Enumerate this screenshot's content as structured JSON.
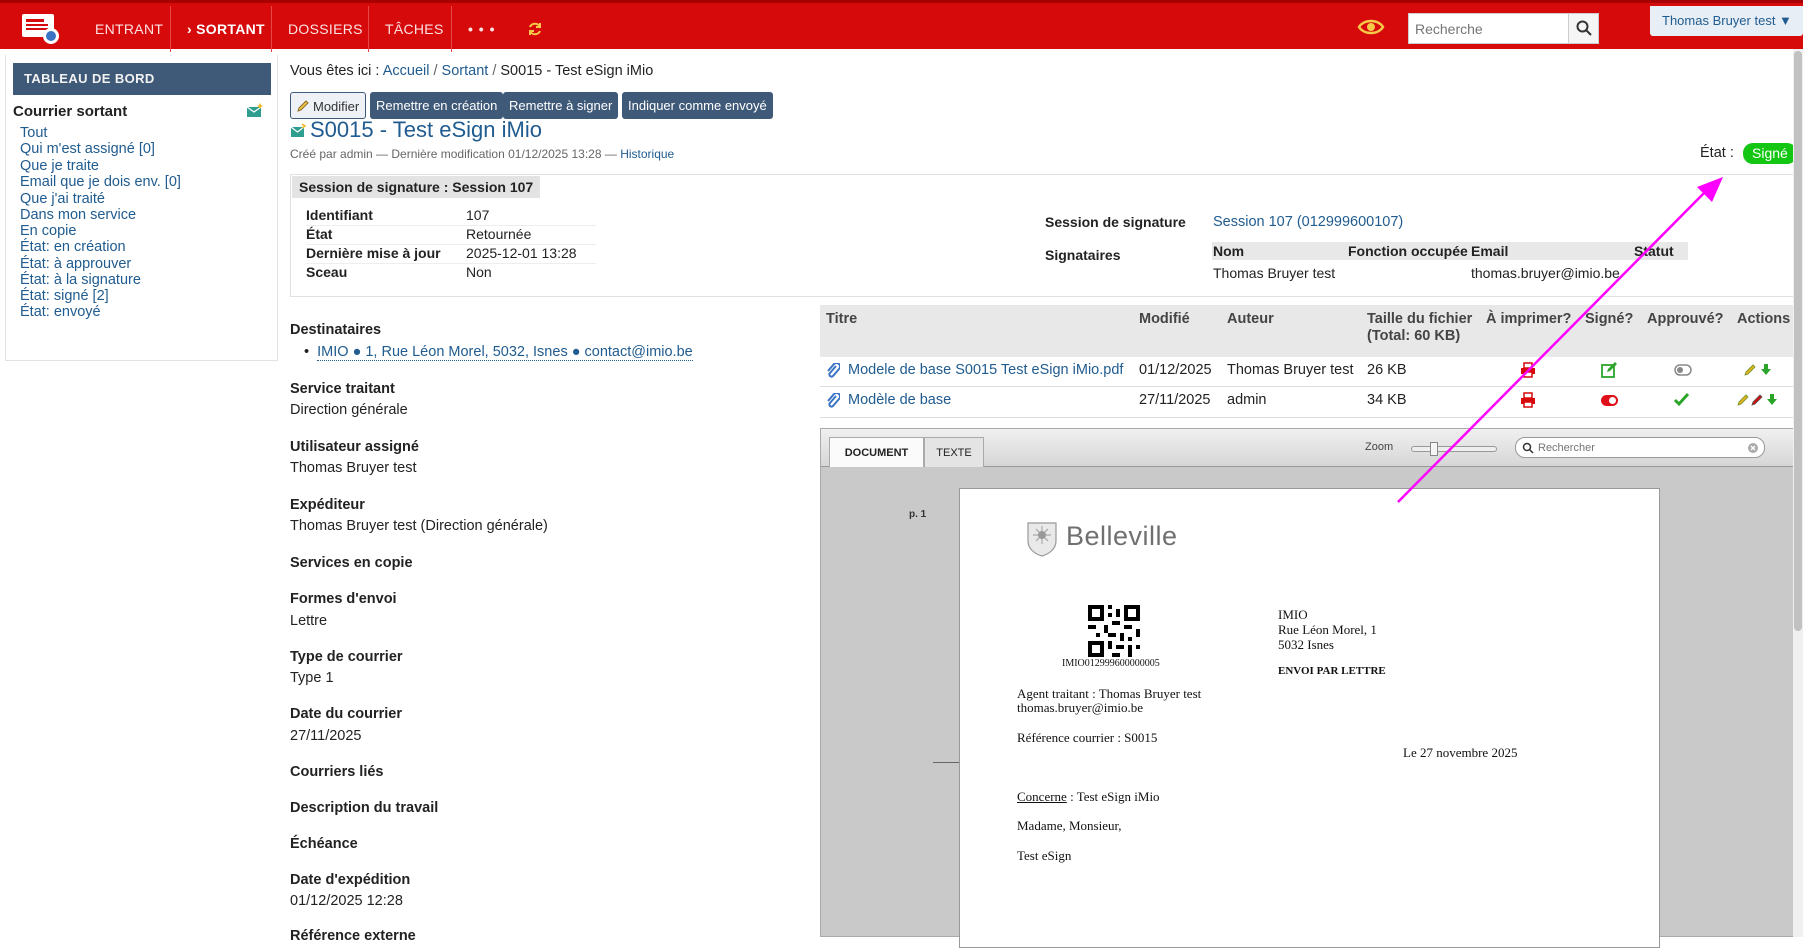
{
  "topbar": {
    "nav": [
      "ENTRANT",
      "› SORTANT",
      "DOSSIERS",
      "TÂCHES",
      "• • •"
    ],
    "search_placeholder": "Recherche",
    "user": "Thomas Bruyer test ▼"
  },
  "sidebar": {
    "header": "TABLEAU DE BORD",
    "title": "Courrier sortant",
    "items": [
      "Tout",
      "Qui m'est assigné [0]",
      "Que je traite",
      "Email que je dois env. [0]",
      "Que j'ai traité",
      "Dans mon service",
      "En copie",
      "État: en création",
      "État: à approuver",
      "État: à la signature",
      "État: signé [2]",
      "État: envoyé"
    ]
  },
  "breadcrumb": {
    "prefix": "Vous êtes ici :",
    "home": "Accueil",
    "sep1": "/",
    "section": "Sortant",
    "sep2": "/",
    "current": "S0015 - Test eSign iMio"
  },
  "actions": [
    "Modifier",
    "Remettre en création",
    "Remettre à signer",
    "Indiquer comme envoyé"
  ],
  "doc": {
    "title": "S0015 - Test eSign iMio",
    "byline": "Créé par admin — Dernière modification 01/12/2025 13:28 —",
    "history": "Historique",
    "state_label": "État :",
    "state": "Signé"
  },
  "session": {
    "title": "Session de signature : Session 107",
    "fields": [
      {
        "k": "Identifiant",
        "v": "107"
      },
      {
        "k": "État",
        "v": "Retournée"
      },
      {
        "k": "Dernière mise à jour",
        "v": "2025-12-01 13:28"
      },
      {
        "k": "Sceau",
        "v": "Non"
      }
    ],
    "link_label": "Session de signature",
    "link": "Session 107 (012999600107)",
    "signers_label": "Signataires",
    "signers_cols": [
      "Nom",
      "Fonction occupée",
      "Email",
      "Statut"
    ],
    "signer": {
      "name": "Thomas Bruyer test",
      "email": "thomas.bruyer@imio.be"
    }
  },
  "fields": [
    {
      "label": "Destinataires",
      "value": ""
    },
    {
      "label": "Service traitant",
      "value": "Direction générale"
    },
    {
      "label": "Utilisateur assigné",
      "value": "Thomas Bruyer test"
    },
    {
      "label": "Expéditeur",
      "value": "Thomas Bruyer test (Direction générale)"
    },
    {
      "label": "Services en copie",
      "value": ""
    },
    {
      "label": "Formes d'envoi",
      "value": "Lettre"
    },
    {
      "label": "Type de courrier",
      "value": "Type 1"
    },
    {
      "label": "Date du courrier",
      "value": "27/11/2025"
    },
    {
      "label": "Courriers liés",
      "value": ""
    },
    {
      "label": "Description du travail",
      "value": ""
    },
    {
      "label": "Échéance",
      "value": ""
    },
    {
      "label": "Date d'expédition",
      "value": "01/12/2025 12:28"
    },
    {
      "label": "Référence externe",
      "value": ""
    }
  ],
  "recipient": "IMIO ● 1, Rue Léon Morel, 5032, Isnes ● contact@imio.be",
  "files": {
    "headers": [
      "Titre",
      "Modifié",
      "Auteur",
      "Taille du fichier (Total: 60 KB)",
      "À imprimer?",
      "Signé?",
      "Approuvé?",
      "Actions"
    ],
    "rows": [
      {
        "title": "Modele de base S0015 Test eSign iMio.pdf",
        "date": "01/12/2025",
        "author": "Thomas Bruyer test",
        "size": "26 KB"
      },
      {
        "title": "Modèle de base",
        "date": "27/11/2025",
        "author": "admin",
        "size": "34 KB"
      }
    ]
  },
  "viewer": {
    "tabs": [
      "DOCUMENT",
      "TEXTE"
    ],
    "zoom_label": "Zoom",
    "search_placeholder": "Rechercher",
    "page_label": "p. 1",
    "letter": {
      "brand": "Belleville",
      "qr_code": "IMIO012999600000005",
      "addr": [
        "IMIO",
        "Rue Léon Morel, 1",
        "5032 Isnes"
      ],
      "envoi": "ENVOI PAR LETTRE",
      "agent": "Agent traitant : Thomas Bruyer test",
      "email": "thomas.bruyer@imio.be",
      "ref": "Référence courrier : S0015",
      "date": "Le 27 novembre 2025",
      "concerne_label": "Concerne",
      "concerne": " : Test eSign iMio",
      "salutation": "Madame, Monsieur,",
      "body": "Test eSign"
    }
  },
  "colors": {
    "topbar": "#d6090b",
    "accent": "#3f5978",
    "link": "#205c90",
    "signed": "#12c612",
    "annotation": "#ff00ff"
  }
}
